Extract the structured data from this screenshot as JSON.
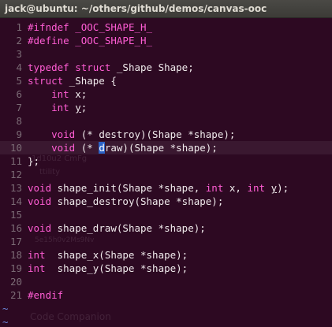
{
  "window": {
    "title": "jack@ubuntu: ~/others/github/demos/canvas-ooc"
  },
  "ghost_text": [
    "1d10u2 CmFg",
    "ttility",
    "5e15h0v2Ms9Nv",
    "Code Companion"
  ],
  "editor": {
    "current_line": 10,
    "lines": [
      {
        "n": "1",
        "tokens": [
          {
            "t": "#ifndef",
            "c": "pp"
          },
          {
            "t": " _OOC_SHAPE_H_",
            "c": "mac"
          }
        ]
      },
      {
        "n": "2",
        "tokens": [
          {
            "t": "#define",
            "c": "pp"
          },
          {
            "t": " _OOC_SHAPE_H_",
            "c": "mac"
          }
        ]
      },
      {
        "n": "3",
        "tokens": []
      },
      {
        "n": "4",
        "tokens": [
          {
            "t": "typedef",
            "c": "kw"
          },
          {
            "t": " ",
            "c": "plain"
          },
          {
            "t": "struct",
            "c": "kw"
          },
          {
            "t": " _Shape Shape;",
            "c": "plain"
          }
        ]
      },
      {
        "n": "5",
        "tokens": [
          {
            "t": "struct",
            "c": "kw"
          },
          {
            "t": " _Shape {",
            "c": "plain"
          }
        ]
      },
      {
        "n": "6",
        "tokens": [
          {
            "t": "    ",
            "c": "plain"
          },
          {
            "t": "int",
            "c": "kw"
          },
          {
            "t": " x;",
            "c": "plain"
          }
        ]
      },
      {
        "n": "7",
        "tokens": [
          {
            "t": "    ",
            "c": "plain"
          },
          {
            "t": "int",
            "c": "kw"
          },
          {
            "t": " ",
            "c": "plain"
          },
          {
            "t": "y",
            "c": "plain ul"
          },
          {
            "t": ";",
            "c": "plain"
          }
        ]
      },
      {
        "n": "8",
        "tokens": []
      },
      {
        "n": "9",
        "tokens": [
          {
            "t": "    ",
            "c": "plain"
          },
          {
            "t": "void",
            "c": "kw"
          },
          {
            "t": " (* destroy)(Shape *shape);",
            "c": "plain"
          }
        ]
      },
      {
        "n": "10",
        "tokens": [
          {
            "t": "    ",
            "c": "plain"
          },
          {
            "t": "void",
            "c": "kw"
          },
          {
            "t": " (* ",
            "c": "plain"
          },
          {
            "t": "d",
            "c": "cursor"
          },
          {
            "t": "raw)(Shape *shape);",
            "c": "plain"
          }
        ]
      },
      {
        "n": "11",
        "tokens": [
          {
            "t": "};",
            "c": "plain"
          }
        ]
      },
      {
        "n": "12",
        "tokens": []
      },
      {
        "n": "13",
        "tokens": [
          {
            "t": "void",
            "c": "kw"
          },
          {
            "t": " shape_init(Shape *shape, ",
            "c": "plain"
          },
          {
            "t": "int",
            "c": "kw"
          },
          {
            "t": " x, ",
            "c": "plain"
          },
          {
            "t": "int",
            "c": "kw"
          },
          {
            "t": " ",
            "c": "plain"
          },
          {
            "t": "y",
            "c": "plain ul"
          },
          {
            "t": ");",
            "c": "plain"
          }
        ]
      },
      {
        "n": "14",
        "tokens": [
          {
            "t": "void",
            "c": "kw"
          },
          {
            "t": " shape_destroy(Shape *shape);",
            "c": "plain"
          }
        ]
      },
      {
        "n": "15",
        "tokens": []
      },
      {
        "n": "16",
        "tokens": [
          {
            "t": "void",
            "c": "kw"
          },
          {
            "t": " shape_draw(Shape *shape);",
            "c": "plain"
          }
        ]
      },
      {
        "n": "17",
        "tokens": []
      },
      {
        "n": "18",
        "tokens": [
          {
            "t": "int",
            "c": "kw"
          },
          {
            "t": "  shape_x(Shape *shape);",
            "c": "plain"
          }
        ]
      },
      {
        "n": "19",
        "tokens": [
          {
            "t": "int",
            "c": "kw"
          },
          {
            "t": "  shape_y(Shape *shape);",
            "c": "plain"
          }
        ]
      },
      {
        "n": "20",
        "tokens": []
      },
      {
        "n": "21",
        "tokens": [
          {
            "t": "#endif",
            "c": "pp"
          }
        ]
      }
    ],
    "tilde_lines": [
      "~",
      "~"
    ]
  },
  "colors": {
    "background": "#2d0922",
    "keyword": "#ff5dd4",
    "text": "#f0eaec",
    "line_number": "#7b6b75",
    "tilde": "#6a86d9",
    "cursor": "#2b62c6",
    "current_line_bg": "#3a1830"
  }
}
